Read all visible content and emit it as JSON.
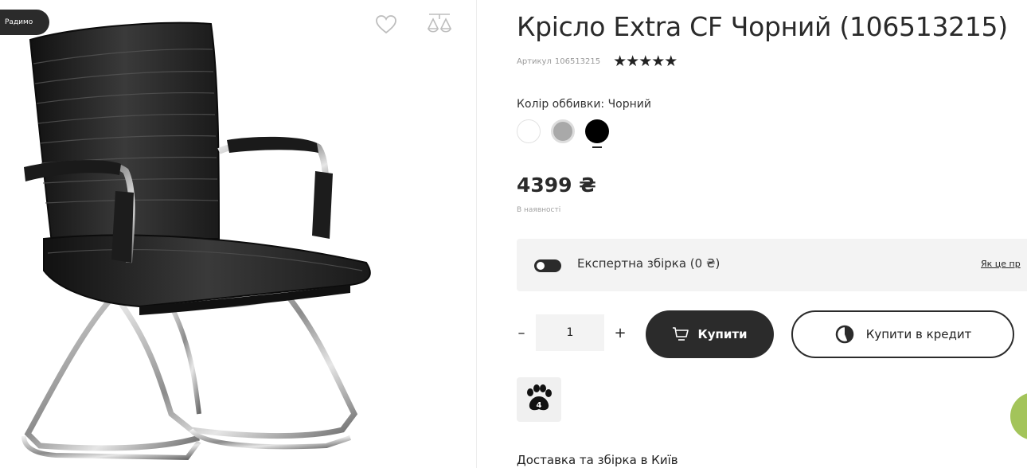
{
  "gallery": {
    "badge": "Радимо",
    "image_alt": "Крісло Extra CF Чорний"
  },
  "product": {
    "title": "Крісло Extra CF Чорний (106513215)",
    "sku_label": "Артикул",
    "sku_value": "106513215",
    "rating_stars": "★★★★★",
    "rating_value": 5,
    "color_label": "Колір оббивки: Чорний",
    "color_options": [
      "white",
      "grey",
      "black"
    ],
    "selected_color": "black",
    "colors": {
      "white": "#ffffff",
      "grey": "#a9a9a9",
      "black": "#000000"
    },
    "price": "4399 ₴",
    "stock": "В наявності"
  },
  "assembly": {
    "label": "Експертна збірка (0 ₴)",
    "link": "Як це пр",
    "enabled": true
  },
  "cart": {
    "minus": "–",
    "quantity": "1",
    "plus": "+",
    "buy_label": "Купити",
    "credit_label": "Купити в кредит"
  },
  "badge_icon": {
    "name": "paw-icon",
    "number": "4"
  },
  "delivery": {
    "title": "Доставка та збірка в Київ"
  },
  "theme": {
    "dark": "#2b2b2b",
    "panel": "#f3f3f3",
    "chat": "#a3c45a"
  }
}
